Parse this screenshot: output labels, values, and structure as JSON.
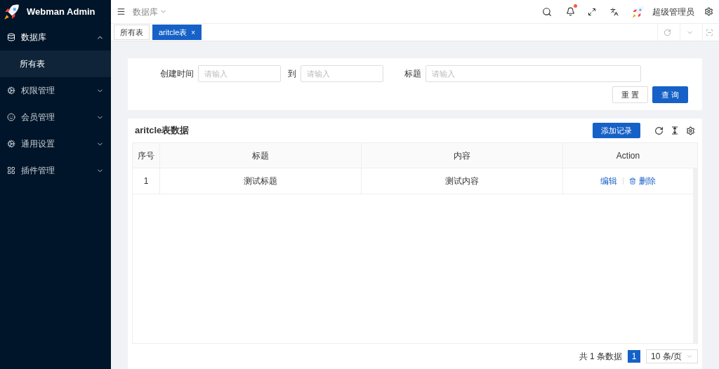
{
  "app": {
    "title": "Webman Admin"
  },
  "sidebar": {
    "items": [
      {
        "label": "数据库",
        "expanded": true,
        "children": [
          {
            "label": "所有表",
            "selected": true
          }
        ]
      },
      {
        "label": "权限管理",
        "expanded": false
      },
      {
        "label": "会员管理",
        "expanded": false
      },
      {
        "label": "通用设置",
        "expanded": false
      },
      {
        "label": "插件管理",
        "expanded": false
      }
    ]
  },
  "header": {
    "breadcrumb": "数据库",
    "user": "超级管理员",
    "has_notification": true
  },
  "tabs": [
    {
      "label": "所有表",
      "selected": false
    },
    {
      "label": "aritcle表",
      "selected": true,
      "close": "×"
    }
  ],
  "search": {
    "fields": [
      {
        "label": "创建时间",
        "placeholder": "请输入",
        "kind": "short"
      },
      {
        "label": "到",
        "placeholder": "请输入",
        "kind": "short"
      },
      {
        "label": "标题",
        "placeholder": "请输入",
        "kind": "long"
      }
    ],
    "buttons": [
      {
        "label": "重 置",
        "kind": "default"
      },
      {
        "label": "查 询",
        "kind": "primary"
      }
    ]
  },
  "table": {
    "title": "aritcle表数据",
    "add_button": "添加记录",
    "columns": [
      "序号",
      "标题",
      "内容",
      "Action"
    ],
    "rows": [
      {
        "cells": [
          "1",
          "测试标题",
          "测试内容"
        ],
        "actions": [
          "编辑",
          "删除"
        ]
      }
    ]
  },
  "pagination": {
    "total": "共 1 条数据",
    "pages": [
      {
        "label": "1",
        "selected": true
      }
    ],
    "page_size": "10 条/页"
  }
}
